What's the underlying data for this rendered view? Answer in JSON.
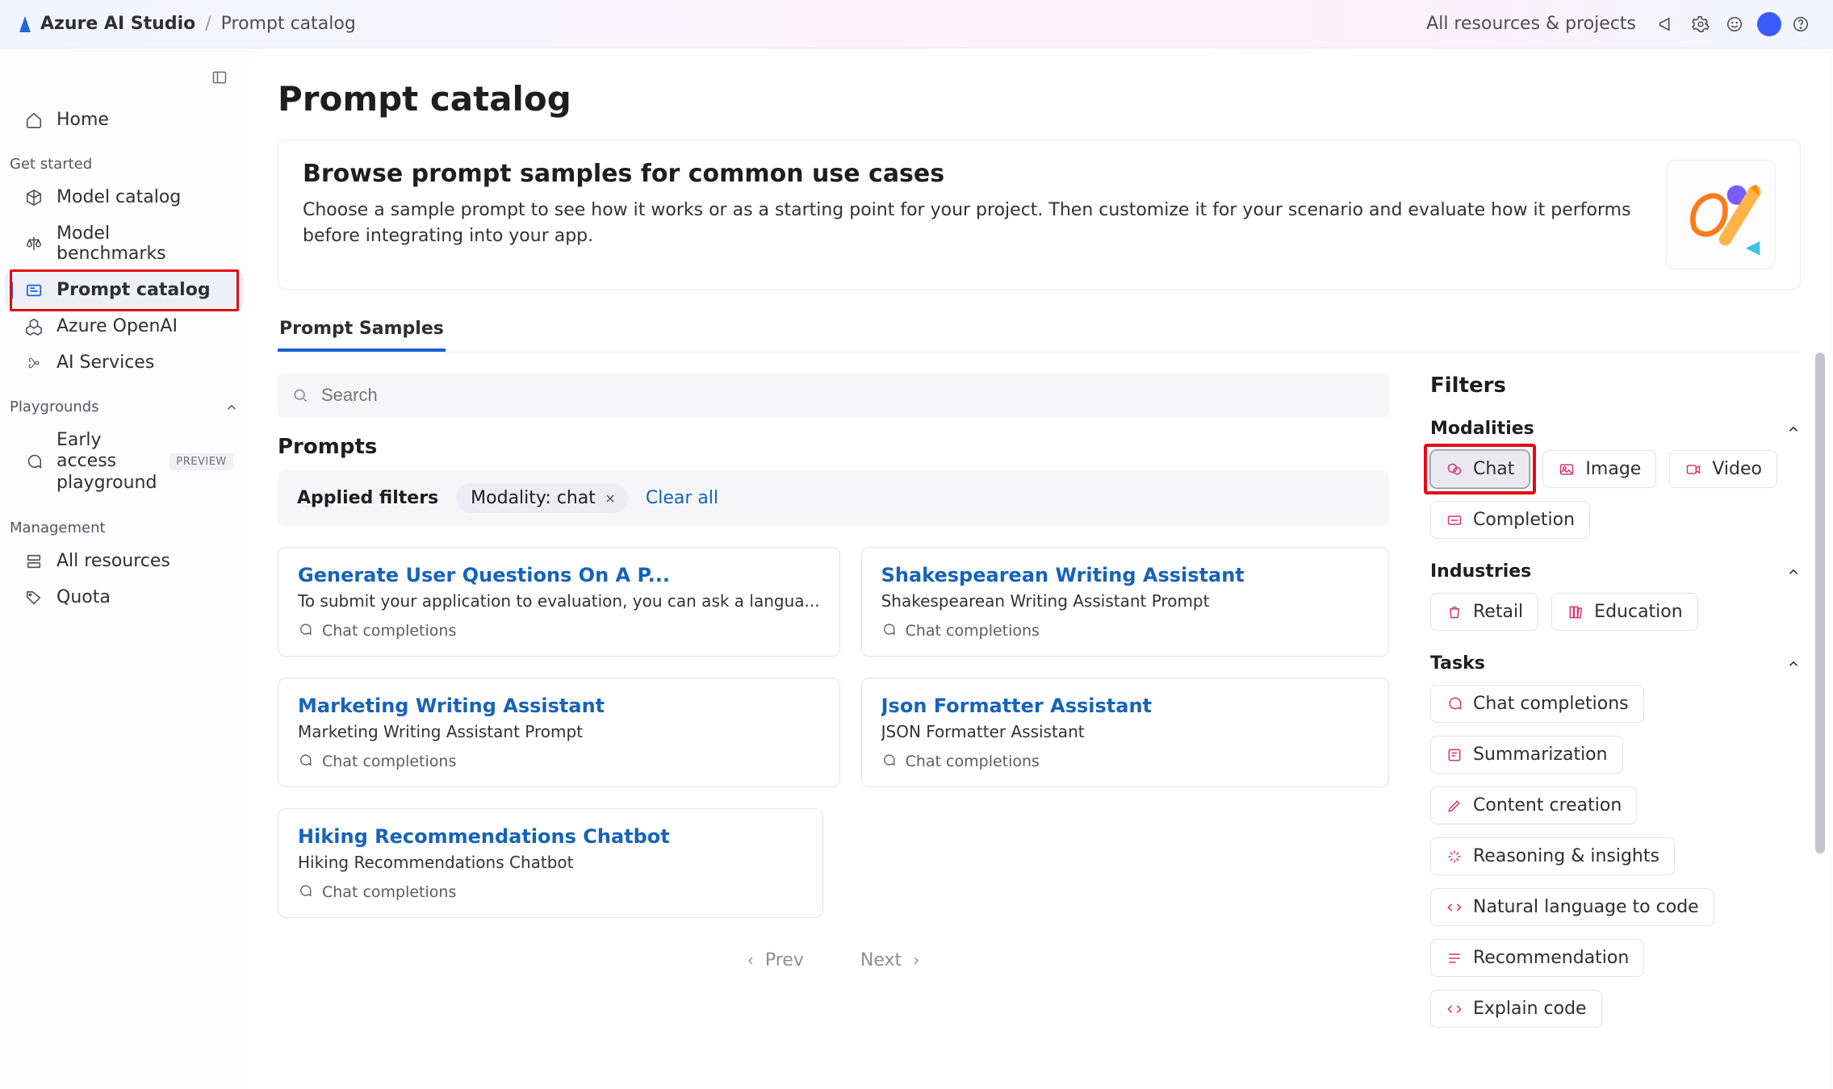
{
  "header": {
    "app_name": "Azure AI Studio",
    "breadcrumb_current": "Prompt catalog",
    "resources_label": "All resources & projects"
  },
  "sidebar": {
    "home": "Home",
    "sections": {
      "get_started": {
        "label": "Get started",
        "items": {
          "model_catalog": "Model catalog",
          "model_benchmarks": "Model benchmarks",
          "prompt_catalog": "Prompt catalog",
          "azure_openai": "Azure OpenAI",
          "ai_services": "AI Services"
        }
      },
      "playgrounds": {
        "label": "Playgrounds",
        "items": {
          "early_access": "Early access playground",
          "early_access_badge": "PREVIEW"
        }
      },
      "management": {
        "label": "Management",
        "items": {
          "all_resources": "All resources",
          "quota": "Quota"
        }
      }
    }
  },
  "main": {
    "page_title": "Prompt catalog",
    "banner": {
      "heading": "Browse prompt samples for common use cases",
      "body": "Choose a sample prompt to see how it works or as a starting point for your project. Then customize it for your scenario and evaluate how it performs before integrating into your app."
    },
    "tab_samples": "Prompt Samples",
    "search_placeholder": "Search",
    "prompts_heading": "Prompts",
    "applied": {
      "label": "Applied filters",
      "chip": "Modality: chat",
      "clear": "Clear all"
    },
    "cards": [
      {
        "title": "Generate User Questions On A P...",
        "desc": "To submit your application to evaluation, you can ask a langua...",
        "tag": "Chat completions"
      },
      {
        "title": "Shakespearean Writing Assistant",
        "desc": "Shakespearean Writing Assistant Prompt",
        "tag": "Chat completions"
      },
      {
        "title": "Marketing Writing Assistant",
        "desc": "Marketing Writing Assistant Prompt",
        "tag": "Chat completions"
      },
      {
        "title": "Json Formatter Assistant",
        "desc": "JSON Formatter Assistant",
        "tag": "Chat completions"
      },
      {
        "title": "Hiking Recommendations Chatbot",
        "desc": "Hiking Recommendations Chatbot",
        "tag": "Chat completions"
      }
    ],
    "pager": {
      "prev": "Prev",
      "next": "Next"
    }
  },
  "filters": {
    "title": "Filters",
    "modalities": {
      "label": "Modalities",
      "chat": "Chat",
      "image": "Image",
      "video": "Video",
      "completion": "Completion"
    },
    "industries": {
      "label": "Industries",
      "retail": "Retail",
      "education": "Education"
    },
    "tasks": {
      "label": "Tasks",
      "chat_completions": "Chat completions",
      "summarization": "Summarization",
      "content_creation": "Content creation",
      "reasoning": "Reasoning & insights",
      "nl_to_code": "Natural language to code",
      "recommendation": "Recommendation",
      "explain_code": "Explain code"
    }
  }
}
